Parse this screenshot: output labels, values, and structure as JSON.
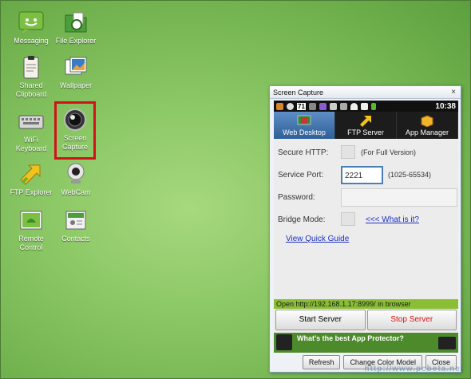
{
  "desktop": {
    "icons": [
      {
        "label": "Messaging"
      },
      {
        "label": "File Explorer"
      },
      {
        "label": "Shared Clipboard"
      },
      {
        "label": "Wallpaper"
      },
      {
        "label": "WiFi Keyboard"
      },
      {
        "label": "Screen Capture"
      },
      {
        "label": "FTP Explorer"
      },
      {
        "label": "WebCam"
      },
      {
        "label": "Remote Control"
      },
      {
        "label": "Contacts"
      }
    ],
    "selected_icon": "Screen Capture"
  },
  "window": {
    "title": "Screen Capture",
    "close_glyph": "×",
    "status": {
      "clock": "10:38",
      "badge": "71"
    },
    "tabs": [
      {
        "label": "Web Desktop",
        "active": true
      },
      {
        "label": "FTP Server",
        "active": false
      },
      {
        "label": "App Manager",
        "active": false
      }
    ],
    "form": {
      "secure_http_label": "Secure HTTP:",
      "secure_http_note": "(For Full Version)",
      "service_port_label": "Service Port:",
      "service_port_value": "2221",
      "service_port_range": "(1025-65534)",
      "password_label": "Password:",
      "password_value": "",
      "bridge_mode_label": "Bridge Mode:",
      "bridge_mode_link": "<<< What is it?",
      "quick_guide_link": "View Quick Guide"
    },
    "url_text": "Open http://192.168.1.17:8999/ in browser",
    "start_button": "Start Server",
    "stop_button": "Stop Server",
    "ad_text": "What's the best App Protector?",
    "footer": {
      "refresh": "Refresh",
      "change_color": "Change Color Model",
      "close": "Close"
    }
  },
  "watermark": "http://www.pcbeta.net"
}
